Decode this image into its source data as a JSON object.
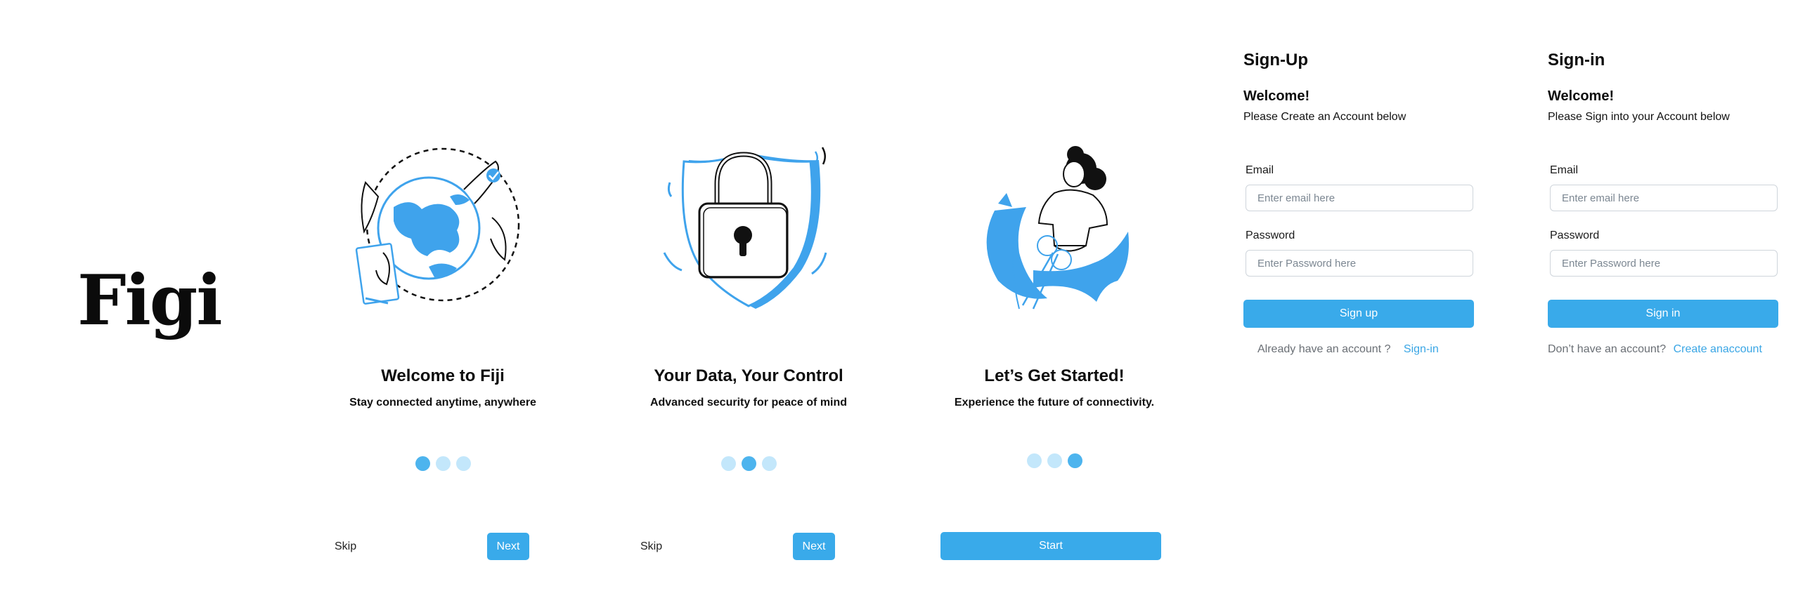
{
  "brand": {
    "logo_text": "Figi"
  },
  "colors": {
    "accent": "#39aaea",
    "dot_active": "#4db4ee",
    "dot_inactive": "#c3e7fb",
    "link": "#3aa6e5"
  },
  "onboarding": [
    {
      "illustration": "globe-with-hands-illustration",
      "title": "Welcome to Fiji",
      "subtitle": "Stay connected anytime, anywhere",
      "active_dot": 0,
      "skip_label": "Skip",
      "next_label": "Next"
    },
    {
      "illustration": "shield-padlock-illustration",
      "title": "Your Data, Your Control",
      "subtitle": "Advanced security for peace of mind",
      "active_dot": 1,
      "skip_label": "Skip",
      "next_label": "Next"
    },
    {
      "illustration": "woman-cutting-ribbon-illustration",
      "title": "Let’s Get Started!",
      "subtitle": "Experience the future of connectivity.",
      "active_dot": 2,
      "start_label": "Start"
    }
  ],
  "signup": {
    "title": "Sign-Up",
    "welcome": "Welcome!",
    "description": "Please Create an Account below",
    "email_label": "Email",
    "email_placeholder": "Enter email here",
    "password_label": "Password",
    "password_placeholder": "Enter Password here",
    "button_label": "Sign up",
    "footer_text": "Already have an account ?",
    "footer_link": "Sign-in"
  },
  "signin": {
    "title": "Sign-in",
    "welcome": "Welcome!",
    "description": "Please Sign into your Account below",
    "email_label": "Email",
    "email_placeholder": "Enter email here",
    "password_label": "Password",
    "password_placeholder": "Enter Password here",
    "button_label": "Sign in",
    "footer_text": "Don’t have an account?",
    "footer_link": "Create anaccount"
  }
}
